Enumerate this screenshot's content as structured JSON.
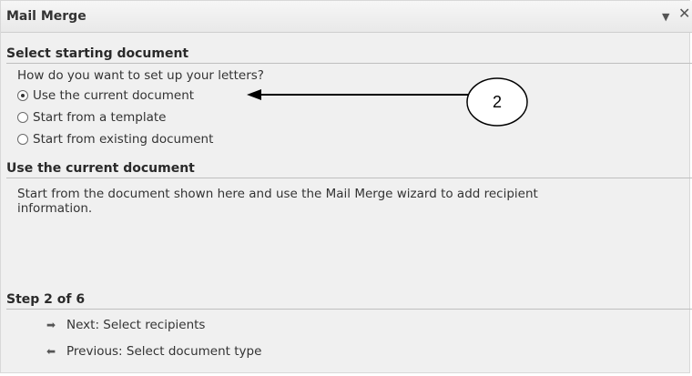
{
  "panel": {
    "title": "Mail Merge",
    "menu_icon": "chevron-down-icon",
    "close_icon": "close-icon"
  },
  "section1": {
    "header": "Select starting document",
    "question": "How do you want to set up your letters?",
    "options": [
      {
        "label": "Use the current document",
        "checked": true
      },
      {
        "label": "Start from a template",
        "checked": false
      },
      {
        "label": "Start from existing document",
        "checked": false
      }
    ]
  },
  "section2": {
    "header": "Use the current document",
    "description_line1": "Start from the document shown here and use the Mail Merge wizard to add recipient",
    "description_line2": "information."
  },
  "step": {
    "header": "Step 2 of 6",
    "next_label": "Next: Select recipients",
    "previous_label": "Previous: Select document type",
    "next_icon": "arrow-right-icon",
    "previous_icon": "arrow-left-icon"
  },
  "annotation": {
    "number": "2"
  }
}
